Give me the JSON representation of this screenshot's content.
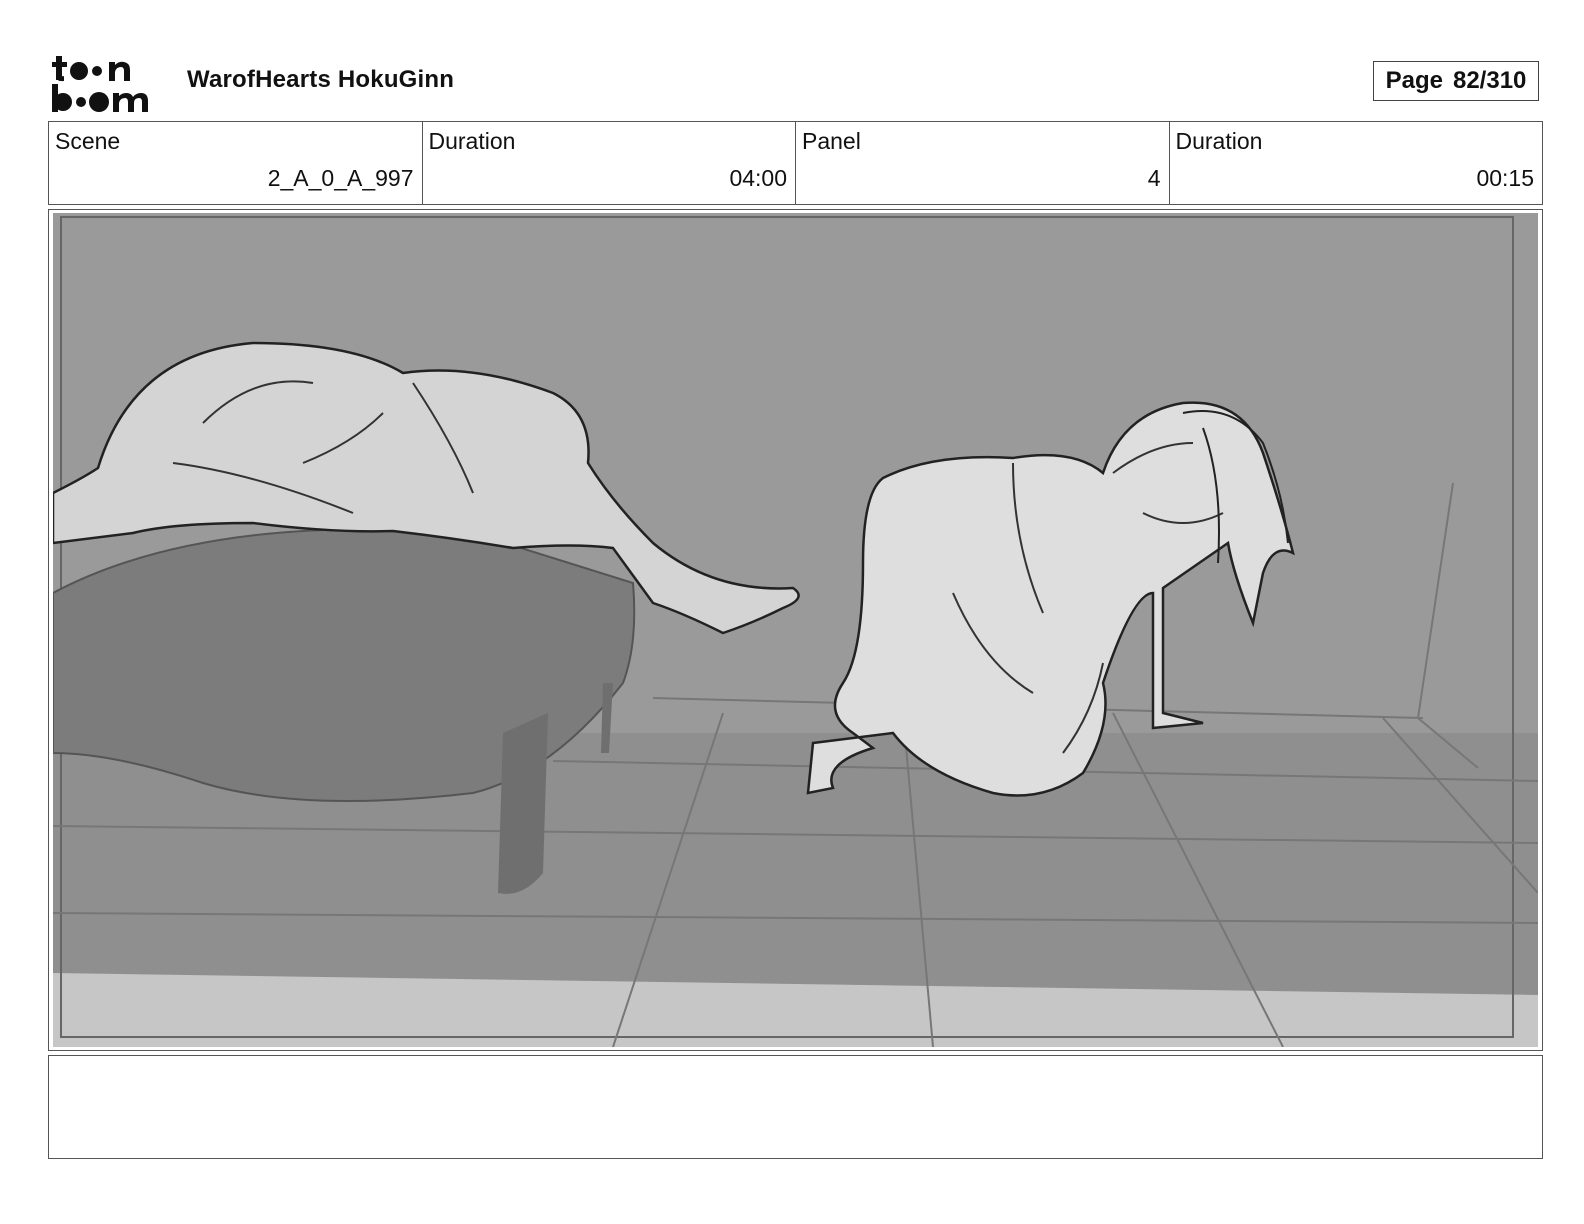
{
  "header": {
    "logo_text": "toon boom",
    "project_title": "WarofHearts HokuGinn",
    "page_label": "Page",
    "page_value": "82/310"
  },
  "info": {
    "scene_label": "Scene",
    "scene_value": "2_A_0_A_997",
    "scene_duration_label": "Duration",
    "scene_duration_value": "04:00",
    "panel_label": "Panel",
    "panel_value": "4",
    "panel_duration_label": "Duration",
    "panel_duration_value": "00:15"
  },
  "notes": {
    "text": ""
  }
}
